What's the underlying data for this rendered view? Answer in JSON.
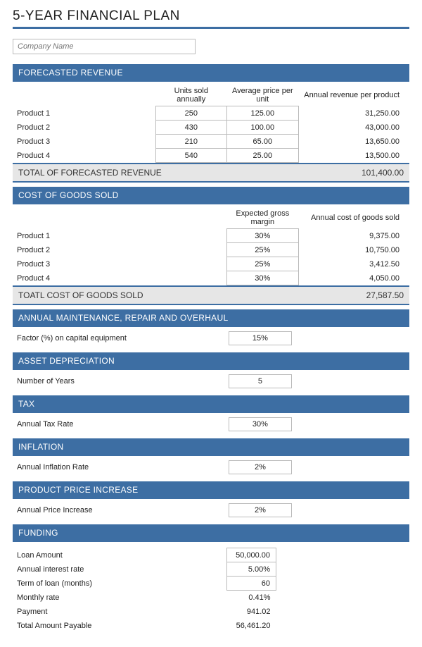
{
  "title": "5-YEAR FINANCIAL PLAN",
  "company_placeholder": "Company Name",
  "sections": {
    "revenue": {
      "header": "FORECASTED REVENUE",
      "col_units": "Units sold annually",
      "col_price": "Average price per unit",
      "col_annual": "Annual revenue per product",
      "rows": [
        {
          "name": "Product 1",
          "units": "250",
          "price": "125.00",
          "annual": "31,250.00"
        },
        {
          "name": "Product 2",
          "units": "430",
          "price": "100.00",
          "annual": "43,000.00"
        },
        {
          "name": "Product 3",
          "units": "210",
          "price": "65.00",
          "annual": "13,650.00"
        },
        {
          "name": "Product 4",
          "units": "540",
          "price": "25.00",
          "annual": "13,500.00"
        }
      ],
      "total_label": "TOTAL OF FORECASTED REVENUE",
      "total_value": "101,400.00"
    },
    "cogs": {
      "header": "COST OF GOODS SOLD",
      "col_margin": "Expected gross margin",
      "col_annual": "Annual cost of goods sold",
      "rows": [
        {
          "name": "Product 1",
          "margin": "30%",
          "annual": "9,375.00"
        },
        {
          "name": "Product 2",
          "margin": "25%",
          "annual": "10,750.00"
        },
        {
          "name": "Product 3",
          "margin": "25%",
          "annual": "3,412.50"
        },
        {
          "name": "Product 4",
          "margin": "30%",
          "annual": "4,050.00"
        }
      ],
      "total_label": "TOATL COST OF GOODS SOLD",
      "total_value": "27,587.50"
    },
    "maintenance": {
      "header": "ANNUAL MAINTENANCE, REPAIR AND OVERHAUL",
      "label": "Factor (%) on capital equipment",
      "value": "15%"
    },
    "depreciation": {
      "header": "ASSET DEPRECIATION",
      "label": "Number of Years",
      "value": "5"
    },
    "tax": {
      "header": "TAX",
      "label": "Annual Tax Rate",
      "value": "30%"
    },
    "inflation": {
      "header": "INFLATION",
      "label": "Annual Inflation Rate",
      "value": "2%"
    },
    "price_increase": {
      "header": "PRODUCT PRICE INCREASE",
      "label": "Annual Price Increase",
      "value": "2%"
    },
    "funding": {
      "header": "FUNDING",
      "rows": [
        {
          "label": "Loan Amount",
          "value": "50,000.00",
          "boxed": true
        },
        {
          "label": "Annual interest rate",
          "value": "5.00%",
          "boxed": true
        },
        {
          "label": "Term of loan (months)",
          "value": "60",
          "boxed": true
        },
        {
          "label": "Monthly rate",
          "value": "0.41%",
          "boxed": false
        },
        {
          "label": "Payment",
          "value": "941.02",
          "boxed": false
        },
        {
          "label": "Total Amount Payable",
          "value": "56,461.20",
          "boxed": false
        }
      ]
    }
  }
}
